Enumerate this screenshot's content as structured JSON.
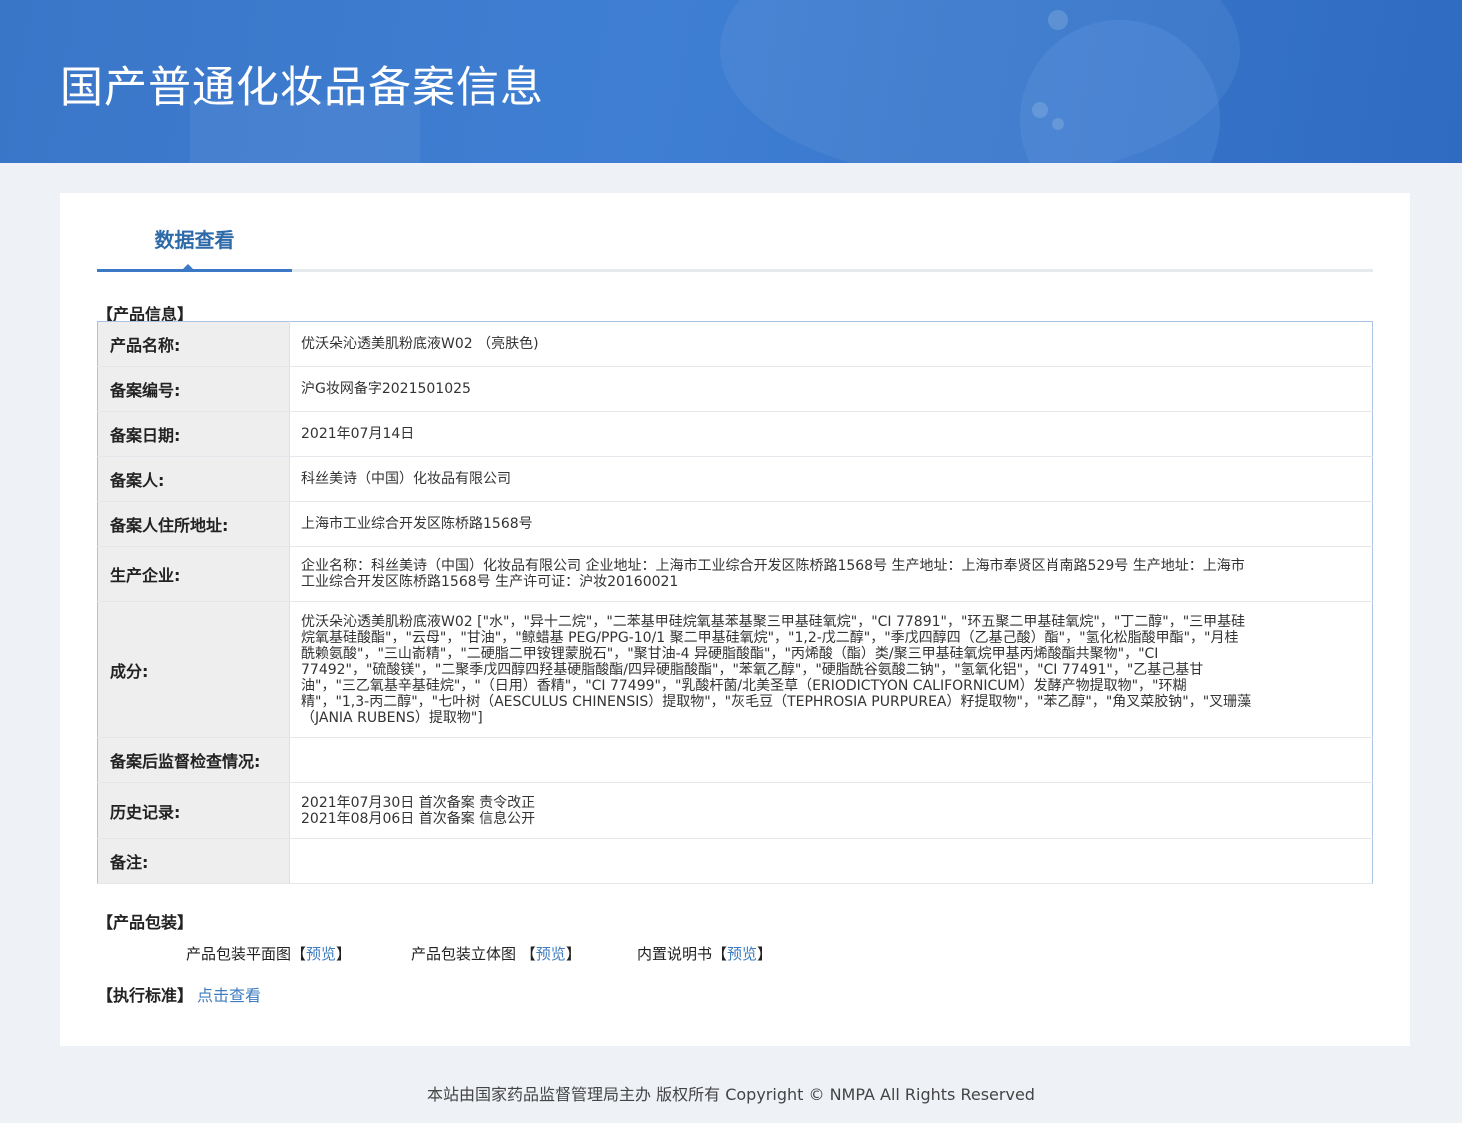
{
  "banner": {
    "title": "国产普通化妆品备案信息"
  },
  "tabs": [
    {
      "label": "数据查看"
    }
  ],
  "product_info": {
    "heading": "【产品信息】",
    "rows": [
      {
        "label": "产品名称:",
        "value": "优沃朵沁透美肌粉底液W02 （亮肤色)"
      },
      {
        "label": "备案编号:",
        "value": "沪G妆网备字2021501025"
      },
      {
        "label": "备案日期:",
        "value": "2021年07月14日"
      },
      {
        "label": "备案人:",
        "value": "科丝美诗（中国）化妆品有限公司"
      },
      {
        "label": "备案人住所地址:",
        "value": "上海市工业综合开发区陈桥路1568号"
      },
      {
        "label": "生产企业:",
        "lines": [
          "企业名称：科丝美诗（中国）化妆品有限公司 企业地址：上海市工业综合开发区陈桥路1568号 生产地址：上海市奉贤区肖南路529号 生产地址：上海市",
          "工业综合开发区陈桥路1568号 生产许可证：沪妆20160021"
        ]
      },
      {
        "label": "成分:",
        "lines": [
          "优沃朵沁透美肌粉底液W02 [\"水\"，\"异十二烷\"，\"二苯基甲硅烷氧基苯基聚三甲基硅氧烷\"，\"CI 77891\"，\"环五聚二甲基硅氧烷\"，\"丁二醇\"，\"三甲基硅",
          "烷氧基硅酸酯\"，\"云母\"，\"甘油\"，\"鲸蜡基 PEG/PPG-10/1 聚二甲基硅氧烷\"，\"1,2-戊二醇\"，\"季戊四醇四（乙基己酸）酯\"，\"氢化松脂酸甲酯\"，\"月桂",
          "酰赖氨酸\"，\"三山嵛精\"，\"二硬脂二甲铵锂蒙脱石\"，\"聚甘油-4 异硬脂酸酯\"，\"丙烯酸（酯）类/聚三甲基硅氧烷甲基丙烯酸酯共聚物\"，\"CI",
          "77492\"，\"硫酸镁\"，\"二聚季戊四醇四羟基硬脂酸酯/四异硬脂酸酯\"，\"苯氧乙醇\"，\"硬脂酰谷氨酸二钠\"，\"氢氧化铝\"，\"CI 77491\"，\"乙基己基甘",
          "油\"，\"三乙氧基辛基硅烷\"，\"（日用）香精\"，\"CI 77499\"，\"乳酸杆菌/北美圣草（ERIODICTYON CALIFORNICUM）发酵产物提取物\"，\"环糊",
          "精\"，\"1,3-丙二醇\"，\"七叶树（AESCULUS CHINENSIS）提取物\"，\"灰毛豆（TEPHROSIA PURPUREA）籽提取物\"，\"苯乙醇\"，\"角叉菜胶钠\"，\"叉珊藻",
          "（JANIA RUBENS）提取物\"]"
        ]
      },
      {
        "label": "备案后监督检查情况:",
        "value": ""
      },
      {
        "label": "历史记录:",
        "lines": [
          "2021年07月30日 首次备案 责令改正",
          "2021年08月06日 首次备案 信息公开"
        ]
      },
      {
        "label": "备注:",
        "value": ""
      }
    ]
  },
  "packaging": {
    "heading": "【产品包装】",
    "items": [
      {
        "label": "产品包装平面图",
        "open": "【",
        "link": "预览",
        "close": "】"
      },
      {
        "label": "产品包装立体图 ",
        "open": "【",
        "link": "预览",
        "close": "】"
      },
      {
        "label": "内置说明书",
        "open": "【",
        "link": "预览",
        "close": "】"
      }
    ]
  },
  "standard": {
    "heading": "【执行标准】",
    "link": "点击查看"
  },
  "footer": {
    "text": "本站由国家药品监督管理局主办 版权所有 Copyright © NMPA All Rights Reserved"
  }
}
